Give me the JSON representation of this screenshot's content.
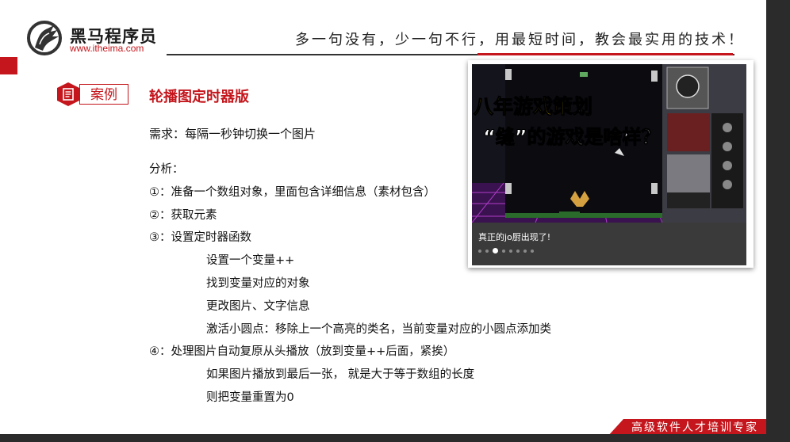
{
  "header": {
    "logo_title": "黑马程序员",
    "logo_url": "www.itheima.com",
    "slogan": "多一句没有，少一句不行，用最短时间，教会最实用的技术！"
  },
  "case": {
    "badge": "案例",
    "title": "轮播图定时器版"
  },
  "content": {
    "requirement": "需求：每隔一秒钟切换一个图片",
    "analysis": "分析：",
    "step1": "①：准备一个数组对象，里面包含详细信息（素材包含）",
    "step2": "②：获取元素",
    "step3": "③：设置定时器函数",
    "step3_a": "设置一个变量++",
    "step3_b": "找到变量对应的对象",
    "step3_c": "更改图片、文字信息",
    "step3_d": "激活小圆点：移除上一个高亮的类名，当前变量对应的小圆点添加类",
    "step4": "④：处理图片自动复原从头播放（放到变量++后面，紧挨）",
    "step4_a": "如果图片播放到最后一张， 就是大于等于数组的长度",
    "step4_b": "则把变量重置为0"
  },
  "carousel": {
    "image_title_line1": "八年游戏策划",
    "image_title_line2": "“缝”的游戏是啥样？",
    "caption": "真正的jo厨出现了!",
    "dot_count": 8,
    "active_dot": 3
  },
  "footer": {
    "tag": "高级软件人才培训专家"
  },
  "colors": {
    "brand_red": "#c4161c"
  }
}
